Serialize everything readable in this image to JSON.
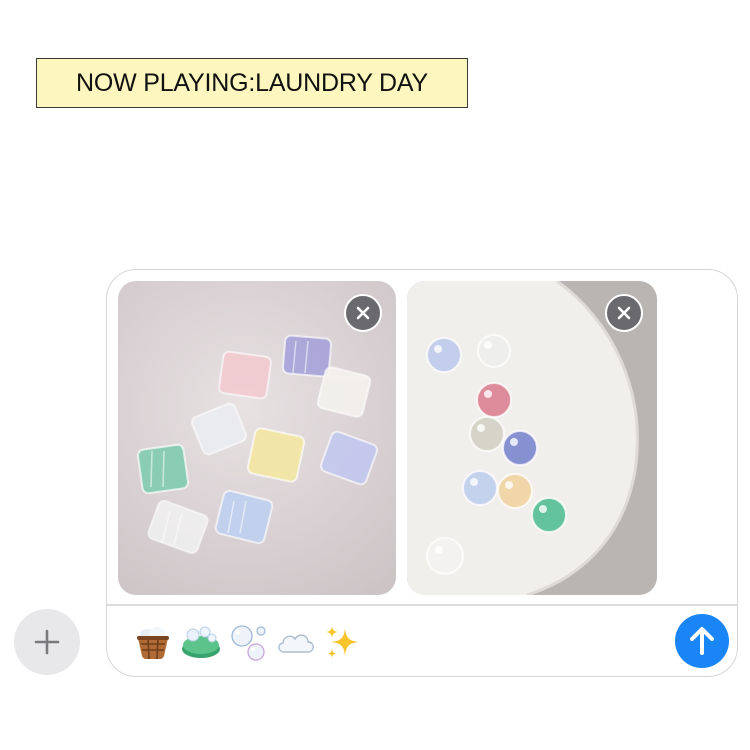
{
  "banner": {
    "text": "NOW PLAYING:LAUNDRY DAY"
  },
  "composer": {
    "attachments": [
      {
        "name": "pastel-square-stones-photo",
        "remove_icon": "close-icon"
      },
      {
        "name": "pastel-round-stones-photo",
        "remove_icon": "close-icon"
      }
    ],
    "message_emojis": [
      "basket",
      "soap",
      "bubbles",
      "cloud",
      "sparkles"
    ],
    "send_icon": "arrow-up-icon",
    "add_icon": "plus-icon"
  },
  "colors": {
    "banner_bg": "#fdf6bf",
    "send_button": "#1a85f7",
    "remove_button": "#6a6a6e",
    "plus_button_bg": "#e8e8ea"
  }
}
